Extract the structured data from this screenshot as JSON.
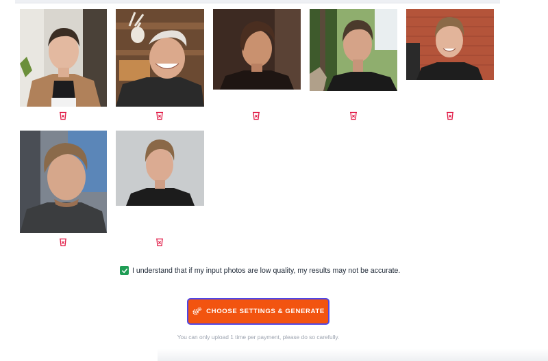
{
  "photos": [
    {
      "name": "photo-1",
      "description": "man in tan blazer against light wall"
    },
    {
      "name": "photo-2",
      "description": "smiling man with backwards cap in room with antlers"
    },
    {
      "name": "photo-3",
      "description": "man with swept hair against dark brown background"
    },
    {
      "name": "photo-4",
      "description": "man in black shirt outdoors among trees"
    },
    {
      "name": "photo-5",
      "description": "smiling man in front of red brick wall"
    },
    {
      "name": "photo-6",
      "description": "man in grey fleece selfie in car"
    },
    {
      "name": "photo-7",
      "description": "man in black shirt against grey wall"
    }
  ],
  "delete_icon": "trash-x-icon",
  "consent": {
    "checked": true,
    "label": "I understand that if my input photos are low quality, my results may not be accurate."
  },
  "generate_button": {
    "label": "CHOOSE SETTINGS & GENERATE",
    "icon": "gears-icon",
    "color": "#f25410",
    "border_color": "#4f46e5"
  },
  "note": "You can only upload 1 time per payment, please do so carefully."
}
